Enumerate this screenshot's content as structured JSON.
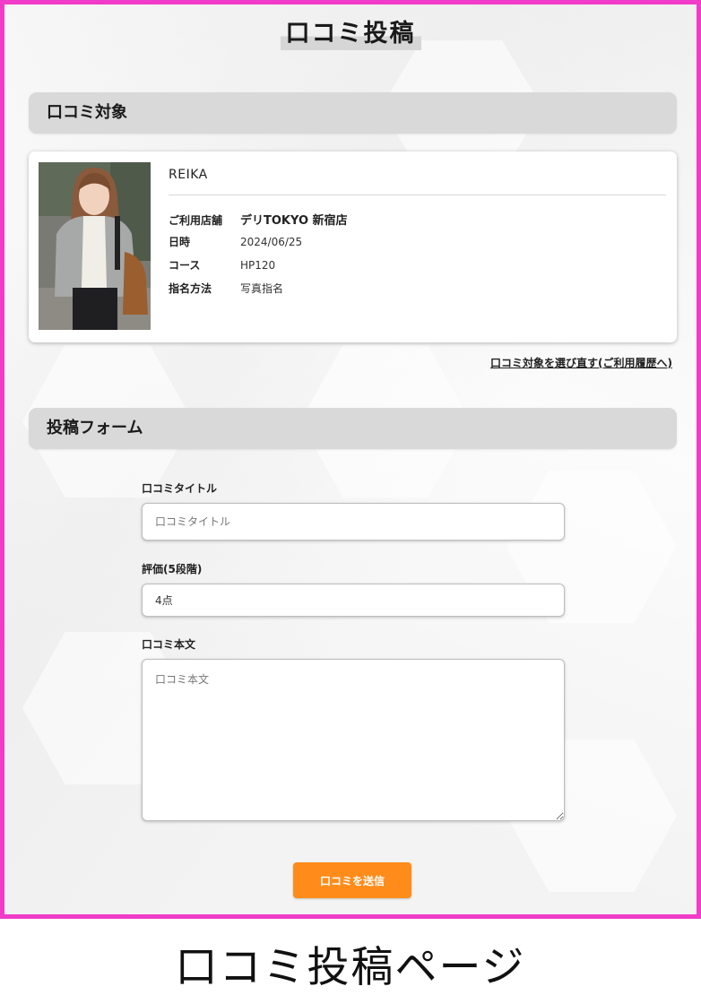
{
  "page": {
    "title": "口コミ投稿",
    "caption": "口コミ投稿ページ",
    "frame_color": "#f03cc8"
  },
  "target_section": {
    "heading": "口コミ対象",
    "card": {
      "name": "REIKA",
      "rows": [
        {
          "label": "ご利用店舗",
          "value": "デリTOKYO 新宿店"
        },
        {
          "label": "日時",
          "value": "2024/06/25"
        },
        {
          "label": "コース",
          "value": "HP120"
        },
        {
          "label": "指名方法",
          "value": "写真指名"
        }
      ]
    },
    "reselect_link": "口コミ対象を選び直す(ご利用履歴へ)"
  },
  "form_section": {
    "heading": "投稿フォーム",
    "title_field": {
      "label": "口コミタイトル",
      "placeholder": "口コミタイトル"
    },
    "rating_field": {
      "label": "評価(5段階)",
      "value": "4点"
    },
    "body_field": {
      "label": "口コミ本文",
      "placeholder": "口コミ本文"
    },
    "submit_label": "口コミを送信",
    "submit_color": "#ff8c1a"
  }
}
